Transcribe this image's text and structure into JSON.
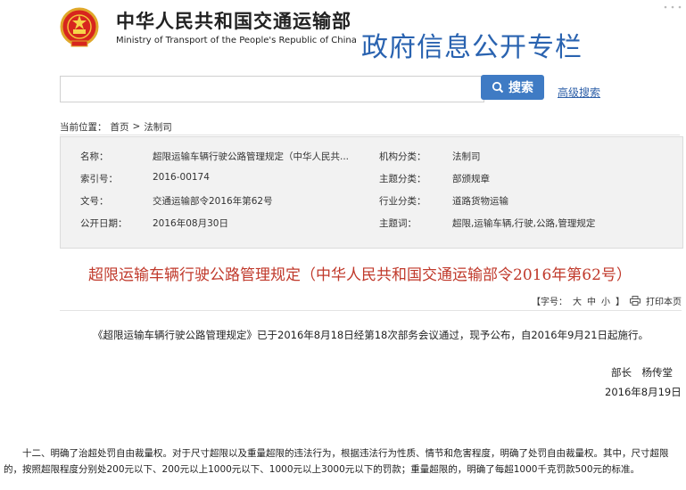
{
  "header": {
    "cn_name": "中华人民共和国交通运输部",
    "en_name": "Ministry of Transport of the People's Republic of China",
    "section_title": "政府信息公开专栏"
  },
  "search": {
    "input_value": "",
    "button_label": "搜索",
    "advanced_label": "高级搜索"
  },
  "breadcrumb": {
    "prefix": "当前位置：",
    "home": "首页",
    "separator": ">",
    "current": "法制司"
  },
  "info": {
    "name_label": "名称：",
    "name_value": "超限运输车辆行驶公路管理规定（中华人民共...",
    "index_label": "索引号：",
    "index_value": "2016-00174",
    "doc_no_label": "文号：",
    "doc_no_value": "交通运输部令2016年第62号",
    "pub_date_label": "公开日期：",
    "pub_date_value": "2016年08月30日",
    "org_label": "机构分类：",
    "org_value": "法制司",
    "topic_label": "主题分类：",
    "topic_value": "部颁规章",
    "industry_label": "行业分类：",
    "industry_value": "道路货物运输",
    "keywords_label": "主题词：",
    "keywords_value": "超限,运输车辆,行驶,公路,管理规定"
  },
  "document": {
    "title": "超限运输车辆行驶公路管理规定（中华人民共和国交通运输部令2016年第62号）",
    "body": "《超限运输车辆行驶公路管理规定》已于2016年8月18日经第18次部务会议通过，现予公布，自2016年9月21日起施行。",
    "signer": "部长　杨传堂",
    "sign_date": "2016年8月19日"
  },
  "tools": {
    "font_label": "【字号：",
    "size_large": "大",
    "size_medium": "中",
    "size_small": "小",
    "close_bracket": "】",
    "print_label": "打印本页"
  },
  "note": {
    "text": "　　十二、明确了治超处罚自由裁量权。对于尺寸超限以及重量超限的违法行为，根据违法行为性质、情节和危害程度，明确了处罚自由裁量权。其中，尺寸超限的，按照超限程度分别处200元以下、200元以上1000元以下、1000元以上3000元以下的罚款；重量超限的，明确了每超1000千克罚款500元的标准。"
  },
  "colors": {
    "accent_blue": "#3f7bc4",
    "section_title_blue": "#2a63b0",
    "title_red": "#c0392b",
    "info_bg": "#f2f2f2"
  }
}
